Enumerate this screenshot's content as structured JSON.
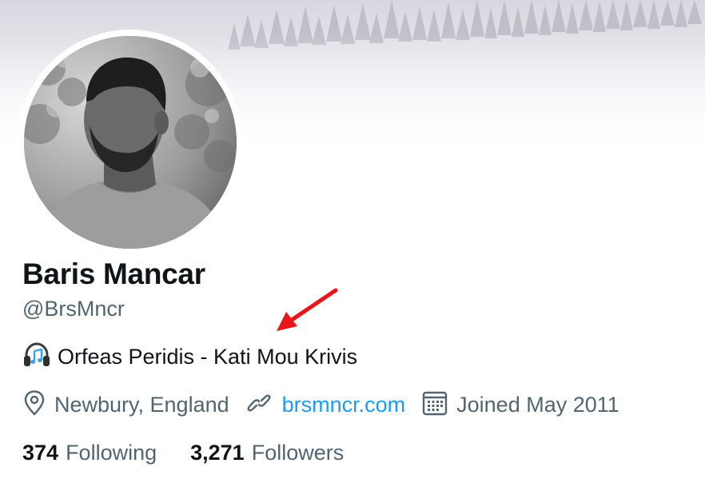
{
  "profile": {
    "name": "Baris Mancar",
    "handle": "@BrsMncr",
    "bio_icon": "headphones-music-emoji",
    "bio": "Orfeas Peridis - Kati Mou Krivis",
    "location": "Newbury, England",
    "website": "brsmncr.com",
    "joined": "Joined May 2011"
  },
  "stats": {
    "following_count": "374",
    "following_label": "Following",
    "followers_count": "3,271",
    "followers_label": "Followers"
  },
  "colors": {
    "text_primary": "#0f1419",
    "text_secondary": "#536471",
    "link": "#1d9bf0",
    "annotation_arrow": "#e8161b"
  }
}
